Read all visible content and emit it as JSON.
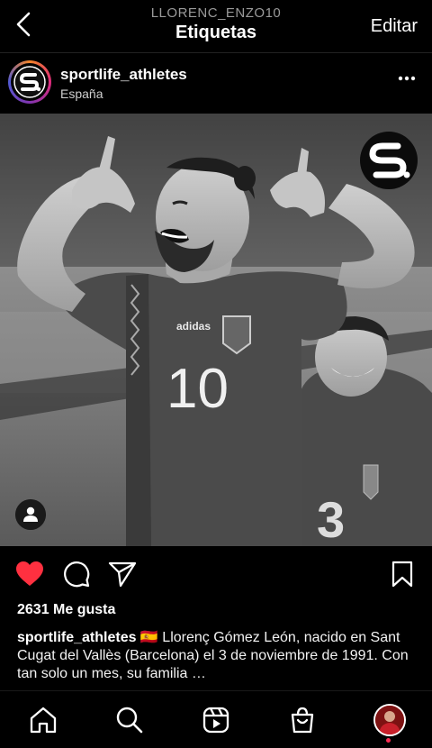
{
  "header": {
    "subtitle": "LLORENC_ENZO10",
    "title": "Etiquetas",
    "edit_label": "Editar"
  },
  "post": {
    "username": "sportlife_athletes",
    "location": "España",
    "image": {
      "jersey_number": "10",
      "jersey_number_2": "3"
    },
    "likes_text": "2631 Me gusta",
    "caption": {
      "username": "sportlife_athletes",
      "text": " 🇪🇸 Llorenç Gómez León, nacido en Sant Cugat del Vallès (Barcelona) el 3 de noviembre de 1991. Con tan solo un mes, su familia …"
    }
  },
  "icons": {
    "back": "chevron-left-icon",
    "more": "more-horizontal-icon",
    "like": "heart-icon",
    "comment": "comment-icon",
    "share": "send-icon",
    "save": "bookmark-icon",
    "tag": "user-tag-icon",
    "nav": [
      "home-icon",
      "search-icon",
      "reels-icon",
      "shop-icon",
      "profile-avatar"
    ]
  },
  "colors": {
    "background": "#000000",
    "like": "#ff3040",
    "muted_text": "#9a9a9a"
  }
}
